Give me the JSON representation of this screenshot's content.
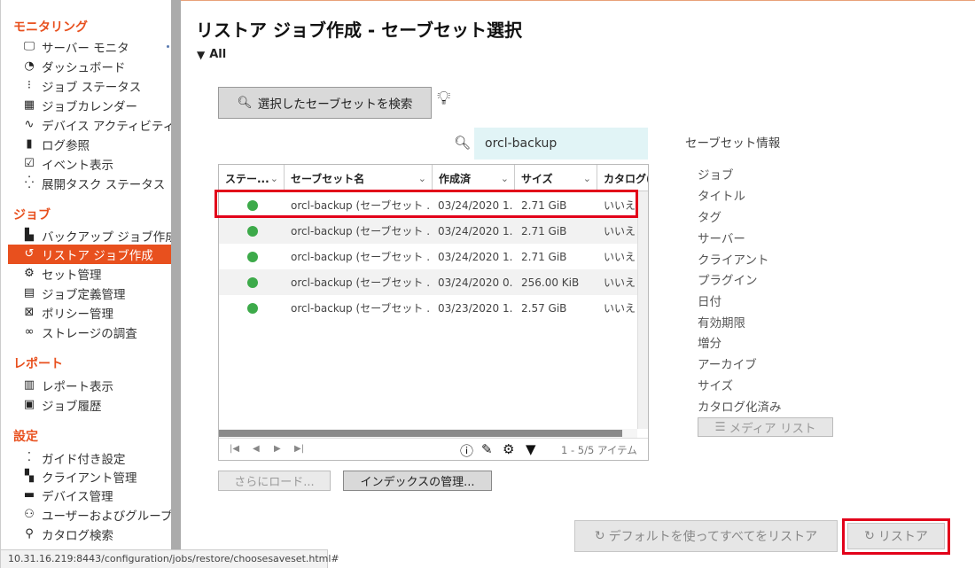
{
  "sidebar": {
    "sections": [
      {
        "title": "モニタリング",
        "items": [
          {
            "label": "サーバー モニタ",
            "icon": "monitor-icon"
          },
          {
            "label": "ダッシュボード",
            "icon": "gauge-icon"
          },
          {
            "label": "ジョブ ステータス",
            "icon": "traffic-light-icon"
          },
          {
            "label": "ジョブカレンダー",
            "icon": "calendar-icon"
          },
          {
            "label": "デバイス アクティビティ",
            "icon": "activity-icon"
          },
          {
            "label": "ログ参照",
            "icon": "book-icon"
          },
          {
            "label": "イベント表示",
            "icon": "checkbox-calendar-icon"
          },
          {
            "label": "展開タスク ステータス",
            "icon": "spinner-icon"
          }
        ]
      },
      {
        "title": "ジョブ",
        "items": [
          {
            "label": "バックアップ ジョブ作成",
            "icon": "backup-icon"
          },
          {
            "label": "リストア ジョブ作成",
            "icon": "restore-icon",
            "active": true
          },
          {
            "label": "セット管理",
            "icon": "gear-set-icon"
          },
          {
            "label": "ジョブ定義管理",
            "icon": "document-icon"
          },
          {
            "label": "ポリシー管理",
            "icon": "policy-icon"
          },
          {
            "label": "ストレージの調査",
            "icon": "binoculars-icon"
          }
        ]
      },
      {
        "title": "レポート",
        "items": [
          {
            "label": "レポート表示",
            "icon": "report-icon"
          },
          {
            "label": "ジョブ履歴",
            "icon": "history-icon"
          }
        ]
      },
      {
        "title": "設定",
        "items": [
          {
            "label": "ガイド付き設定",
            "icon": "footsteps-icon"
          },
          {
            "label": "クライアント管理",
            "icon": "client-icon"
          },
          {
            "label": "デバイス管理",
            "icon": "device-icon"
          },
          {
            "label": "ユーザーおよびグループ",
            "icon": "users-icon"
          },
          {
            "label": "カタログ検索",
            "icon": "catalog-search-icon"
          }
        ]
      }
    ]
  },
  "page": {
    "title": "リストア ジョブ作成 - セーブセット選択",
    "filter_label": "All"
  },
  "toolbar": {
    "search_saveset_label": "選択したセーブセットを検索",
    "search_value": "orcl-backup"
  },
  "grid": {
    "columns": [
      "ステー...",
      "セーブセット名",
      "作成済",
      "サイズ",
      "カタログ("
    ],
    "rows": [
      {
        "status": "green",
        "name": "orcl-backup (セーブセット ...",
        "created": "03/24/2020 1...",
        "size": "2.71 GiB",
        "catalog": "いいえ"
      },
      {
        "status": "green",
        "name": "orcl-backup (セーブセット ...",
        "created": "03/24/2020 1...",
        "size": "2.71 GiB",
        "catalog": "いいえ"
      },
      {
        "status": "green",
        "name": "orcl-backup (セーブセット ...",
        "created": "03/24/2020 1...",
        "size": "2.71 GiB",
        "catalog": "いいえ"
      },
      {
        "status": "green",
        "name": "orcl-backup (セーブセット ...",
        "created": "03/24/2020 0...",
        "size": "256.00 KiB",
        "catalog": "いいえ"
      },
      {
        "status": "green",
        "name": "orcl-backup (セーブセット ...",
        "created": "03/23/2020 1...",
        "size": "2.57 GiB",
        "catalog": "いいえ"
      }
    ],
    "item_count": "1 - 5/5 アイテム",
    "status_color": "#3daa4a"
  },
  "buttons": {
    "load_more": "さらにロード...",
    "manage_index": "インデックスの管理...",
    "media_list": "メディア リスト",
    "restore_all_default": "デフォルトを使ってすべてをリストア",
    "restore": "リストア"
  },
  "info_panel": {
    "title": "セーブセット情報",
    "labels": [
      "ジョブ",
      "タイトル",
      "タグ",
      "サーバー",
      "クライアント",
      "プラグイン",
      "日付",
      "有効期限",
      "増分",
      "アーカイブ",
      "サイズ",
      "カタログ化済み"
    ]
  },
  "status_bar": {
    "url": "10.31.16.219:8443/configuration/jobs/restore/choosesaveset.html#"
  },
  "colors": {
    "accent": "#e8501e",
    "highlight": "#e2001a"
  }
}
